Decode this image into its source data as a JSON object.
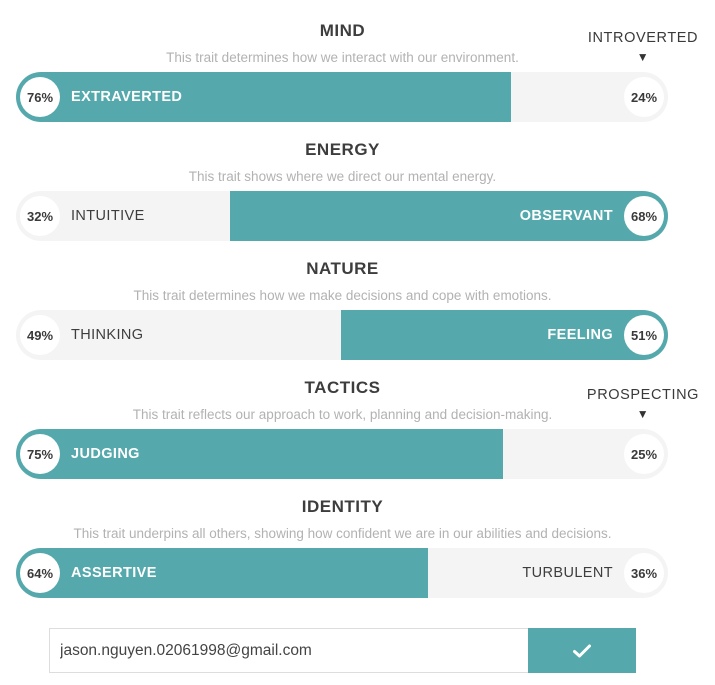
{
  "traits": [
    {
      "title": "MIND",
      "description": "This trait determines how we interact with our environment.",
      "left": {
        "percent": "76%",
        "label": "EXTRAVERTED"
      },
      "right": {
        "percent": "24%",
        "label": ""
      },
      "dominant": "left",
      "fill_percent": 76,
      "indicator": "INTROVERTED"
    },
    {
      "title": "ENERGY",
      "description": "This trait shows where we direct our mental energy.",
      "left": {
        "percent": "32%",
        "label": "INTUITIVE"
      },
      "right": {
        "percent": "68%",
        "label": "OBSERVANT"
      },
      "dominant": "right",
      "fill_percent": 68,
      "indicator": ""
    },
    {
      "title": "NATURE",
      "description": "This trait determines how we make decisions and cope with emotions.",
      "left": {
        "percent": "49%",
        "label": "THINKING"
      },
      "right": {
        "percent": "51%",
        "label": "FEELING"
      },
      "dominant": "right",
      "fill_percent": 51,
      "indicator": ""
    },
    {
      "title": "TACTICS",
      "description": "This trait reflects our approach to work, planning and decision-making.",
      "left": {
        "percent": "75%",
        "label": "JUDGING"
      },
      "right": {
        "percent": "25%",
        "label": ""
      },
      "dominant": "left",
      "fill_percent": 75,
      "indicator": "PROSPECTING"
    },
    {
      "title": "IDENTITY",
      "description": "This trait underpins all others, showing how confident we are in our abilities and decisions.",
      "left": {
        "percent": "64%",
        "label": "ASSERTIVE"
      },
      "right": {
        "percent": "36%",
        "label": "TURBULENT"
      },
      "dominant": "left",
      "fill_percent": 64,
      "indicator": ""
    }
  ],
  "indicator_arrow": "▼",
  "email": {
    "value": "jason.nguyen.02061998@gmail.com",
    "placeholder": ""
  },
  "submit_icon": "checkmark-icon",
  "colors": {
    "accent": "#55a9ac",
    "track": "#f4f4f4",
    "title": "#3d3d3d",
    "description": "#b2b2b2"
  }
}
